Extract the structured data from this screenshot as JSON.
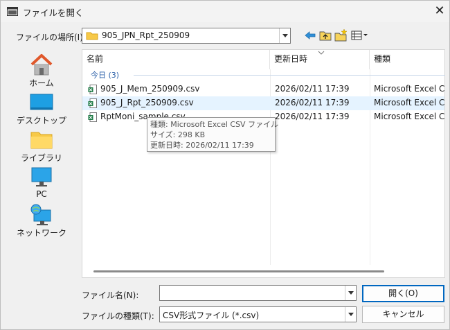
{
  "window": {
    "title": "ファイルを開く",
    "close_glyph": "✕"
  },
  "location": {
    "label": "ファイルの場所(I):",
    "value": "905_JPN_Rpt_250909"
  },
  "toolbar": {
    "icons": [
      "back-arrow-icon",
      "up-folder-icon",
      "new-folder-icon",
      "view-menu-icon"
    ]
  },
  "places": [
    {
      "label": "ホーム",
      "icon": "home-icon"
    },
    {
      "label": "デスクトップ",
      "icon": "desktop-icon"
    },
    {
      "label": "ライブラリ",
      "icon": "library-folder-icon"
    },
    {
      "label": "PC",
      "icon": "pc-monitor-icon"
    },
    {
      "label": "ネットワーク",
      "icon": "network-icon"
    }
  ],
  "list": {
    "columns": [
      "名前",
      "更新日時",
      "種類"
    ],
    "group": "今日 (3)",
    "rows": [
      {
        "name": "905_J_Mem_250909.csv",
        "date": "2026/02/11 17:39",
        "type": "Microsoft Excel CS..."
      },
      {
        "name": "905_J_Rpt_250909.csv",
        "date": "2026/02/11 17:39",
        "type": "Microsoft Excel CS..."
      },
      {
        "name": "RptMoni_sample.csv",
        "date": "2026/02/11 17:39",
        "type": "Microsoft Excel CS..."
      }
    ]
  },
  "tooltip": {
    "line1": "種類: Microsoft Excel CSV ファイル",
    "line2": "サイズ: 298 KB",
    "line3": "更新日時: 2026/02/11 17:39"
  },
  "filename": {
    "label": "ファイル名(N):",
    "value": ""
  },
  "filetype": {
    "label": "ファイルの種類(T):",
    "value": "CSV形式ファイル (*.csv)"
  },
  "buttons": {
    "open": "開く(O)",
    "cancel": "キャンセル"
  },
  "colors": {
    "accent": "#0067c0",
    "group_text": "#2a5fa8",
    "row_highlight": "#e5f3ff"
  }
}
